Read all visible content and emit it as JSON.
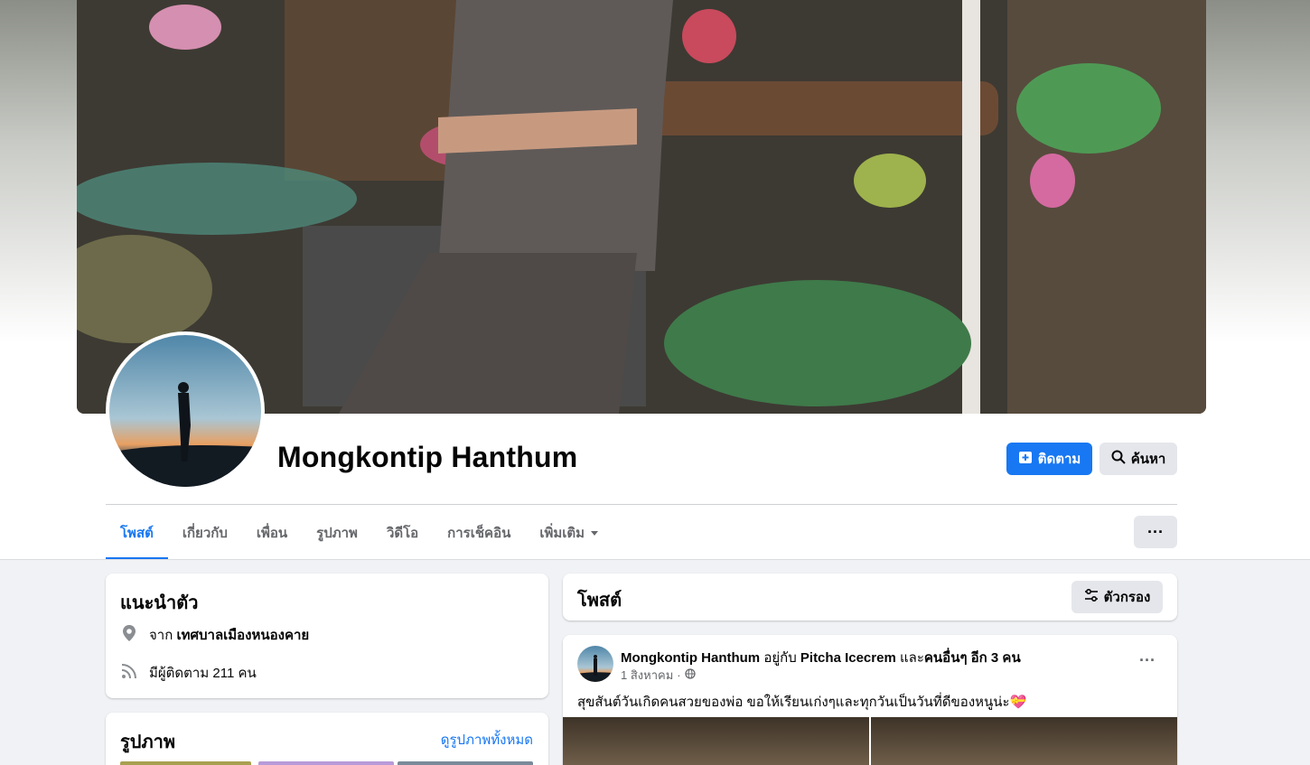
{
  "profile": {
    "name": "Mongkontip Hanthum",
    "follow_label": "ติดตาม",
    "search_label": "ค้นหา",
    "more_label": "···"
  },
  "tabs": [
    {
      "label": "โพสต์"
    },
    {
      "label": "เกี่ยวกับ"
    },
    {
      "label": "เพื่อน"
    },
    {
      "label": "รูปภาพ"
    },
    {
      "label": "วิดีโอ"
    },
    {
      "label": "การเช็คอิน"
    },
    {
      "label": "เพิ่มเติม"
    }
  ],
  "intro": {
    "title": "แนะนำตัว",
    "from_prefix": "จาก",
    "from_place": "เทศบาลเมืองหนองคาย",
    "followers_text": "มีผู้ติดตาม 211 คน"
  },
  "photos": {
    "title": "รูปภาพ",
    "see_all": "ดูรูปภาพทั้งหมด"
  },
  "posts": {
    "title": "โพสต์",
    "filter_label": "ตัวกรอง"
  },
  "post": {
    "author": "Mongkontip Hanthum",
    "with_text": "อยู่กับ",
    "tagged": "Pitcha Icecrem",
    "and_text": "และ",
    "others": "คนอื่นๆ อีก 3 คน",
    "date": "1 สิงหาคม",
    "separator": "·",
    "text": "สุขสันต์วันเกิดคนสวยของพ่อ ขอให้เรียนเก่งๆและทุกวันเป็นวันที่ดีของหนูน่ะ💝",
    "dots": "···"
  },
  "colors": {
    "accent": "#1877f2",
    "secondary_button": "#e4e6eb",
    "page_bg": "#f0f2f5",
    "muted_text": "#65676b"
  }
}
